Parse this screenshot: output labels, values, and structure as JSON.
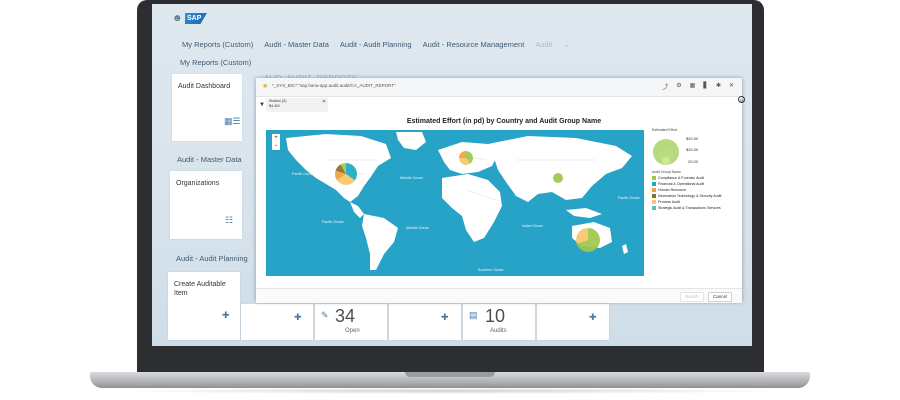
{
  "shell": {
    "logo": "SAP"
  },
  "tabs": [
    "My Reports (Custom)",
    "Audit - Master Data",
    "Audit - Audit Planning",
    "Audit - Resource Management",
    "Audit",
    "⌄"
  ],
  "sections": {
    "my_reports": "My Reports (Custom)",
    "master_data": "Audit - Master Data",
    "audit_planning": "Audit - Audit Planning"
  },
  "tiles": {
    "audit_dashboard": "Audit Dashboard",
    "organizations": "Organizations",
    "create_item": "Create Auditable Item",
    "open_count": "34",
    "open_label": "Open",
    "audits_count": "10",
    "audits_label": "Audits"
  },
  "ghost_title": "AUD_AUDIT_REPORTS",
  "dialog": {
    "url": "*_SYS_BIC*:\"sap.hana-app.audit.audit/CA_AUDIT_REPORT\"",
    "filter_label": "Station (2)",
    "filter_value": "$4.4M",
    "filter_clear": "✕",
    "toolbar_icons": [
      "share-icon",
      "settings-icon",
      "table-icon",
      "bar-chart-icon",
      "gear-icon",
      "close-icon"
    ],
    "ok_label": "Switch",
    "cancel_label": "Cancel"
  },
  "chart_data": {
    "type": "map-bubble",
    "title": "Estimated Effort (in pd) by Country and Audit Group Name",
    "size_legend": {
      "title": "Estimated Effort",
      "values": [
        "$20.00",
        "$20.00",
        "20.00"
      ]
    },
    "color_legend_title": "Audit Group Name",
    "categories": [
      {
        "name": "Compliance & Forensic Audit",
        "color": "#9fc74a"
      },
      {
        "name": "Financial & Operational Audit",
        "color": "#19a9c3"
      },
      {
        "name": "Human Resource",
        "color": "#f2a13a"
      },
      {
        "name": "Information Technology & Security Audit",
        "color": "#8c6d2c"
      },
      {
        "name": "Process Audit",
        "color": "#f6c76b"
      },
      {
        "name": "Strategic Audit & Transactions Services",
        "color": "#51c3c6"
      }
    ],
    "bubbles": [
      {
        "country": "United States",
        "segments": [
          {
            "category": "Financial & Operational Audit",
            "value": 35
          },
          {
            "category": "Process Audit",
            "value": 30
          },
          {
            "category": "Human Resource",
            "value": 15
          },
          {
            "category": "Information Technology & Security Audit",
            "value": 12
          },
          {
            "category": "Compliance & Forensic Audit",
            "value": 8
          }
        ]
      },
      {
        "country": "Germany",
        "segments": [
          {
            "category": "Compliance & Forensic Audit",
            "value": 40
          },
          {
            "category": "Process Audit",
            "value": 35
          },
          {
            "category": "Human Resource",
            "value": 25
          }
        ]
      },
      {
        "country": "China",
        "segments": [
          {
            "category": "Compliance & Forensic Audit",
            "value": 100
          }
        ]
      },
      {
        "country": "Australia",
        "segments": [
          {
            "category": "Compliance & Forensic Audit",
            "value": 70
          },
          {
            "category": "Process Audit",
            "value": 30
          }
        ]
      }
    ],
    "ocean_labels": [
      "Pacific Ocean",
      "Atlantic Ocean",
      "Pacific Ocean",
      "Atlantic Ocean",
      "Indian Ocean",
      "Pacific Ocean",
      "Southern Ocean"
    ]
  }
}
